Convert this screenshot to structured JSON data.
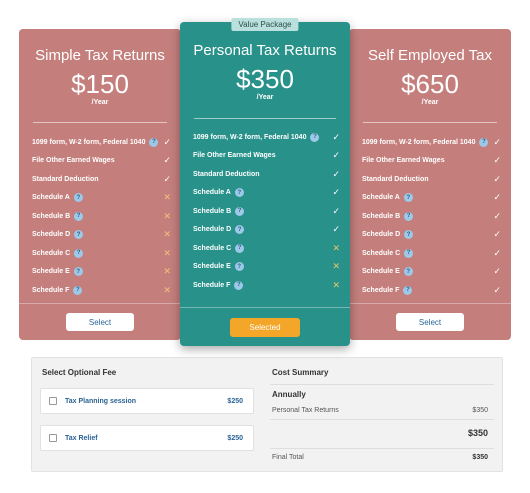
{
  "plans": [
    {
      "title": "Simple Tax Returns",
      "price": "$150",
      "period": "/Year",
      "button": "Select",
      "features": [
        {
          "label": "1099 form, W-2 form, Federal 1040",
          "help": "?",
          "mark": "✓"
        },
        {
          "label": "File Other Earned Wages",
          "help": "",
          "mark": "✓"
        },
        {
          "label": "Standard Deduction",
          "help": "",
          "mark": "✓"
        },
        {
          "label": "Schedule A",
          "help": "?",
          "mark": "✕"
        },
        {
          "label": "Schedule B",
          "help": "?",
          "mark": "✕"
        },
        {
          "label": "Schedule D",
          "help": "?",
          "mark": "✕"
        },
        {
          "label": "Schedule C",
          "help": "?",
          "mark": "✕"
        },
        {
          "label": "Schedule E",
          "help": "?",
          "mark": "✕"
        },
        {
          "label": "Schedule F",
          "help": "?",
          "mark": "✕"
        }
      ]
    },
    {
      "badge": "Value Package",
      "title": "Personal Tax Returns",
      "price": "$350",
      "period": "/Year",
      "button": "Selected",
      "features": [
        {
          "label": "1099 form, W-2 form, Federal 1040",
          "help": "?",
          "mark": "✓"
        },
        {
          "label": "File Other Earned Wages",
          "help": "",
          "mark": "✓"
        },
        {
          "label": "Standard Deduction",
          "help": "",
          "mark": "✓"
        },
        {
          "label": "Schedule A",
          "help": "?",
          "mark": "✓"
        },
        {
          "label": "Schedule B",
          "help": "?",
          "mark": "✓"
        },
        {
          "label": "Schedule D",
          "help": "?",
          "mark": "✓"
        },
        {
          "label": "Schedule C",
          "help": "?",
          "mark": "✕"
        },
        {
          "label": "Schedule E",
          "help": "?",
          "mark": "✕"
        },
        {
          "label": "Schedule F",
          "help": "?",
          "mark": "✕"
        }
      ]
    },
    {
      "title": "Self Employed Tax",
      "price": "$650",
      "period": "/Year",
      "button": "Select",
      "features": [
        {
          "label": "1099 form, W-2 form, Federal 1040",
          "help": "?",
          "mark": "✓"
        },
        {
          "label": "File Other Earned Wages",
          "help": "",
          "mark": "✓"
        },
        {
          "label": "Standard Deduction",
          "help": "",
          "mark": "✓"
        },
        {
          "label": "Schedule A",
          "help": "?",
          "mark": "✓"
        },
        {
          "label": "Schedule B",
          "help": "?",
          "mark": "✓"
        },
        {
          "label": "Schedule D",
          "help": "?",
          "mark": "✓"
        },
        {
          "label": "Schedule C",
          "help": "?",
          "mark": "✓"
        },
        {
          "label": "Schedule E",
          "help": "?",
          "mark": "✓"
        },
        {
          "label": "Schedule F",
          "help": "?",
          "mark": "✓"
        }
      ]
    }
  ],
  "optional_fee": {
    "title": "Select Optional Fee",
    "items": [
      {
        "name": "Tax Planning session",
        "price": "$250"
      },
      {
        "name": "Tax Relief",
        "price": "$250"
      }
    ]
  },
  "cost_summary": {
    "title": "Cost Summary",
    "period": "Annually",
    "item_name": "Personal Tax Returns",
    "item_price": "$350",
    "subtotal": "$350",
    "final_label": "Final Total",
    "final_value": "$350"
  },
  "colors": {
    "side_card": "#c47f7d",
    "featured_card": "#27918a",
    "selected_button": "#f3a628",
    "link_blue": "#2a6394"
  }
}
